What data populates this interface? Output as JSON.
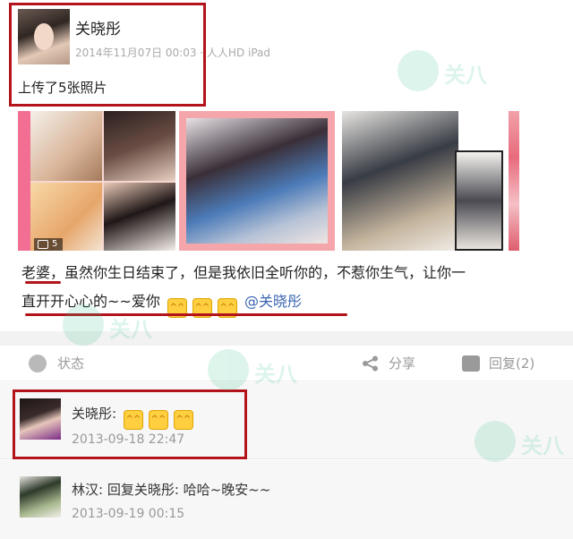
{
  "post": {
    "author": "关晓彤",
    "meta": "2014年11月07日 00:03 · 人人HD iPad",
    "summary": "上传了5张照片",
    "photo_count": "5",
    "text_line1": "老婆，虽然你生日结束了，但是我依旧全听你的，不惹你生气，让你一",
    "text_line2": "直开开心心的~~爱你",
    "mention": "@关晓彤",
    "emoji_name": "blush-emoji"
  },
  "actions": {
    "status": "状态",
    "share": "分享",
    "reply": "回复(2)"
  },
  "comments": [
    {
      "author": "关晓彤:",
      "text": "",
      "time": "2013-09-18 22:47"
    },
    {
      "author": "林汉:",
      "text": "回复关晓彤: 哈哈~晚安~~",
      "time": "2013-09-19 00:15"
    }
  ],
  "watermark": {
    "text": "关八"
  },
  "colors": {
    "highlight": "#b3141c",
    "mention": "#3a64b0",
    "watermark": "#2fbf88"
  }
}
